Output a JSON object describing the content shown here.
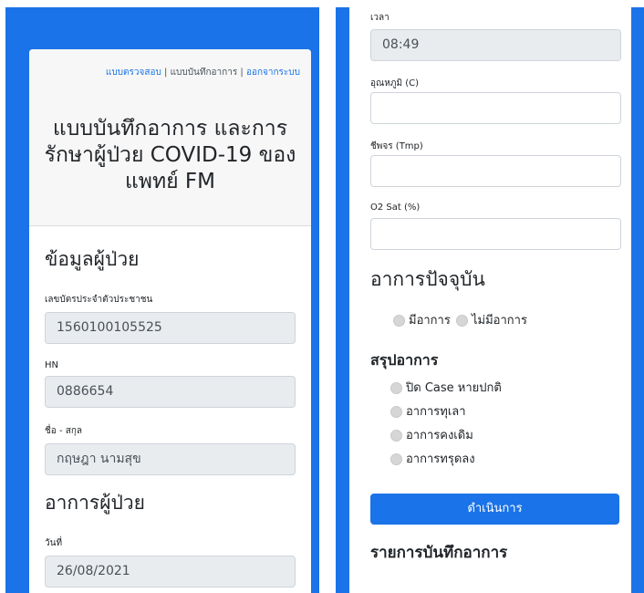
{
  "nav": {
    "check_form": "แบบตรวจสอบ",
    "separator": "|",
    "symptom_log": "แบบบันทึกอาการ",
    "logout": "ออกจากระบบ"
  },
  "page": {
    "title": "แบบบันทึกอาการ และการรักษาผู้ป่วย COVID-19 ของแพทย์ FM"
  },
  "patient": {
    "heading": "ข้อมูลผู้ป่วย",
    "id_label": "เลขบัตรประจำตัวประชาชน",
    "id_value": "1560100105525",
    "hn_label": "HN",
    "hn_value": "0886654",
    "name_label": "ชื่อ - สกุล",
    "name_value": "กฤษฎา นามสุข"
  },
  "symptoms": {
    "heading": "อาการผู้ป่วย",
    "date_label": "วันที่",
    "date_value": "26/08/2021",
    "time_label": "เวลา",
    "time_value": "08:49",
    "temp_label": "อุณหภูมิ (C)",
    "temp_value": "",
    "pulse_label": "ชีพจร (Tmp)",
    "pulse_value": "",
    "o2_label": "O2 Sat (%)",
    "o2_value": ""
  },
  "current": {
    "heading": "อาการปัจจุบัน",
    "options": [
      "มีอาการ",
      "ไม่มีอาการ"
    ]
  },
  "summary": {
    "heading": "สรุปอาการ",
    "options": [
      "ปิด Case หายปกติ",
      "อาการทุเลา",
      "อาการคงเดิม",
      "อาการทรุดลง"
    ]
  },
  "actions": {
    "submit": "ดำเนินการ"
  },
  "records": {
    "heading": "รายการบันทึกอาการ"
  },
  "colors": {
    "primary": "#1a73e8",
    "readonly_bg": "#e9ecef"
  }
}
